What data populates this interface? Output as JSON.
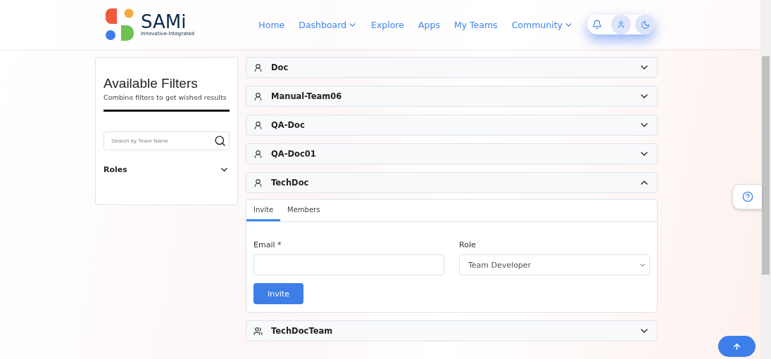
{
  "logo": {
    "name": "SAMi",
    "tagline": "Innovative-Integrated"
  },
  "nav": [
    {
      "label": "Home",
      "kind": "link"
    },
    {
      "label": "Dashboard",
      "kind": "dropdown"
    },
    {
      "label": "Explore",
      "kind": "link"
    },
    {
      "label": "Apps",
      "kind": "link"
    },
    {
      "label": "My Teams",
      "kind": "link"
    },
    {
      "label": "Community",
      "kind": "dropdown"
    }
  ],
  "filters": {
    "title": "Available Filters",
    "subtitle": "Combine filters to get wished results",
    "search": {
      "placeholder": "Search by Team Name"
    },
    "sections": [
      {
        "label": "Roles",
        "expanded": false
      }
    ]
  },
  "teams": [
    {
      "name": "Doc",
      "kind": "single",
      "expanded": false
    },
    {
      "name": "Manual-Team06",
      "kind": "single",
      "expanded": false
    },
    {
      "name": "QA-Doc",
      "kind": "single",
      "expanded": false
    },
    {
      "name": "QA-Doc01",
      "kind": "single",
      "expanded": false
    },
    {
      "name": "TechDoc",
      "kind": "single",
      "expanded": true
    },
    {
      "name": "TechDocTeam",
      "kind": "group",
      "expanded": false
    }
  ],
  "panel": {
    "tabs": [
      {
        "label": "Invite",
        "selected": true
      },
      {
        "label": "Members",
        "selected": false
      }
    ],
    "email": {
      "label": "Email *"
    },
    "role": {
      "label": "Role",
      "value": "Team Developer"
    },
    "submit": "Invite"
  }
}
